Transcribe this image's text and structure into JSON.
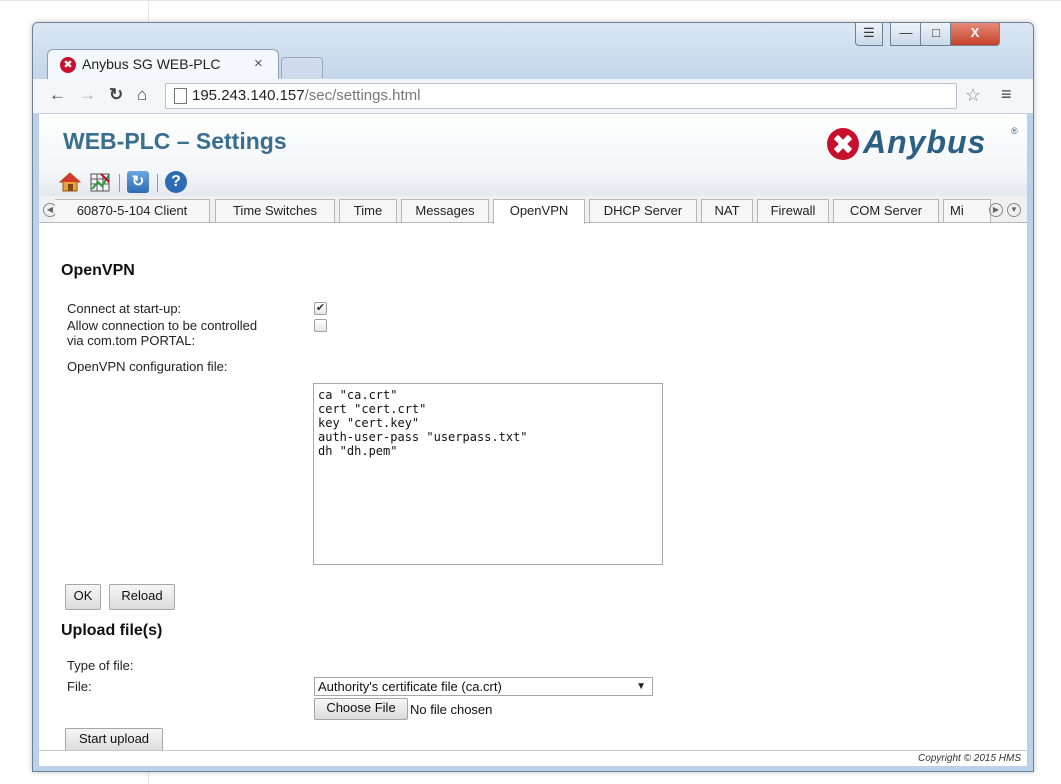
{
  "browser": {
    "tab_title": "Anybus SG WEB-PLC",
    "tab_close": "×",
    "window_controls": {
      "user": "☰",
      "minimize": "—",
      "maximize": "□",
      "close": "X"
    },
    "url_host": "195.243.140.157",
    "url_path": "/sec/settings.html"
  },
  "header": {
    "title": "WEB-PLC – Settings",
    "logo_text": "Anybus",
    "logo_reg": "®"
  },
  "iconbar": [
    "home-icon",
    "grid-icon",
    "refresh-icon",
    "help-icon"
  ],
  "tabs": [
    {
      "label": "60870-5-104 Client"
    },
    {
      "label": "Time Switches"
    },
    {
      "label": "Time"
    },
    {
      "label": "Messages"
    },
    {
      "label": "OpenVPN",
      "active": true
    },
    {
      "label": "DHCP Server"
    },
    {
      "label": "NAT"
    },
    {
      "label": "Firewall"
    },
    {
      "label": "COM Server"
    },
    {
      "label": "Mi"
    }
  ],
  "openvpn": {
    "title": "OpenVPN",
    "connect_label": "Connect at start-up:",
    "connect_checked": true,
    "allow_label_line1": "Allow connection to be controlled",
    "allow_label_line2": "via com.tom PORTAL:",
    "allow_checked": false,
    "config_label": "OpenVPN configuration file:",
    "config_text": "ca \"ca.crt\"\ncert \"cert.crt\"\nkey \"cert.key\"\nauth-user-pass \"userpass.txt\"\ndh \"dh.pem\"",
    "ok_label": "OK",
    "reload_label": "Reload"
  },
  "upload": {
    "title": "Upload file(s)",
    "type_label": "Type of file:",
    "type_value": "Authority's certificate file (ca.crt)",
    "file_label": "File:",
    "choose_label": "Choose File",
    "no_file": "No file chosen",
    "start_label": "Start upload"
  },
  "footer": {
    "copyright": "Copyright © 2015 HMS"
  },
  "colors": {
    "title": "#3a6e8e",
    "brand": "#2b5f84",
    "brand_red": "#c8102e",
    "window_frame": "#b9d1ea"
  }
}
